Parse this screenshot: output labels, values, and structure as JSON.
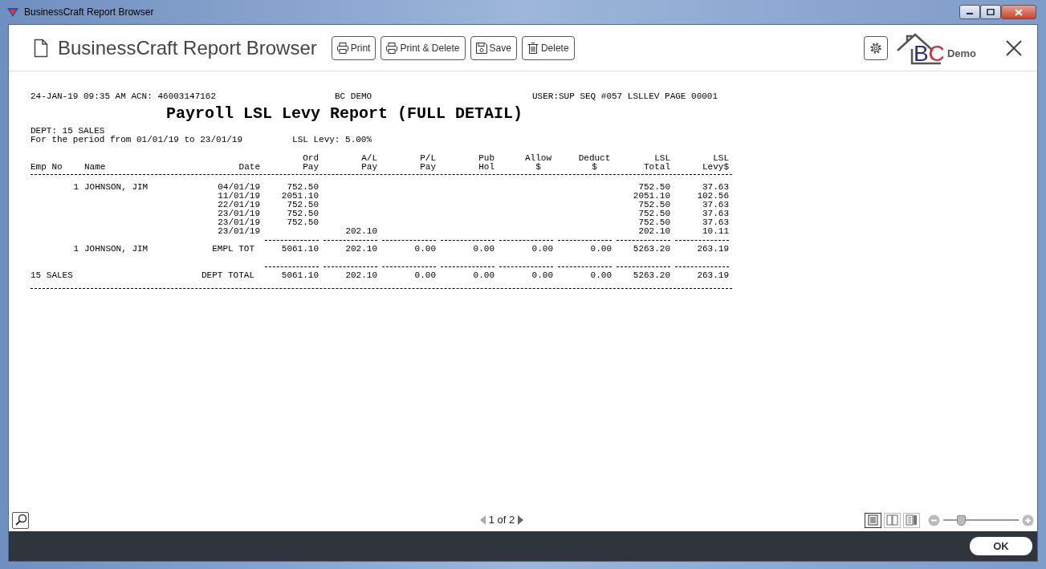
{
  "window": {
    "title": "BusinessCraft Report Browser"
  },
  "header": {
    "title": "BusinessCraft Report Browser",
    "buttons": [
      {
        "kind": "print",
        "label": "Print"
      },
      {
        "kind": "print",
        "label": "Print & Delete"
      },
      {
        "kind": "save",
        "label": "Save"
      },
      {
        "kind": "delete",
        "label": "Delete"
      }
    ],
    "logo": [
      {
        "text": "B",
        "color": "#2b2f7e"
      },
      {
        "text": "C",
        "color": "#d42a35"
      }
    ],
    "logo_caption": "Demo"
  },
  "report": {
    "header_left": "24-JAN-19 09:35 AM ACN: 46003147162",
    "header_center": "BC DEMO",
    "header_right": "USER:SUP SEQ #057 LSLLEV PAGE 00001",
    "title": "Payroll LSL Levy Report (FULL DETAIL)",
    "dept": "DEPT: 15 SALES",
    "period": "For the period from 01/01/19 to 23/01/19",
    "levy": "LSL Levy: 5.00%",
    "header_rows": [
      [
        null,
        null,
        null,
        "Ord",
        "A/L",
        "P/L",
        "Pub",
        "Allow",
        "Deduct",
        "LSL",
        "LSL"
      ],
      [
        "Emp No",
        "Name",
        "Date",
        "Pay",
        "Pay",
        "Pay",
        "Hol",
        "$",
        "$",
        "Total",
        "Levy$"
      ]
    ],
    "rows": [
      {
        "kind": "detail",
        "cells": [
          "1",
          "JOHNSON, JIM",
          "04/01/19",
          "752.50",
          null,
          null,
          null,
          null,
          null,
          "752.50",
          "37.63"
        ]
      },
      {
        "kind": "detail",
        "cells": [
          null,
          null,
          "11/01/19",
          "2051.10",
          null,
          null,
          null,
          null,
          null,
          "2051.10",
          "102.56"
        ]
      },
      {
        "kind": "detail",
        "cells": [
          null,
          null,
          "22/01/19",
          "752.50",
          null,
          null,
          null,
          null,
          null,
          "752.50",
          "37.63"
        ]
      },
      {
        "kind": "detail",
        "cells": [
          null,
          null,
          "23/01/19",
          "752.50",
          null,
          null,
          null,
          null,
          null,
          "752.50",
          "37.63"
        ]
      },
      {
        "kind": "detail",
        "cells": [
          null,
          null,
          "23/01/19",
          "752.50",
          null,
          null,
          null,
          null,
          null,
          "752.50",
          "37.63"
        ]
      },
      {
        "kind": "detail",
        "cells": [
          null,
          null,
          "23/01/19",
          null,
          "202.10",
          null,
          null,
          null,
          null,
          "202.10",
          "10.11"
        ]
      },
      {
        "kind": "subtotal",
        "cells": [
          "1",
          "JOHNSON, JIM",
          "EMPL TOT",
          "5061.10",
          "202.10",
          "0.00",
          "0.00",
          "0.00",
          "0.00",
          "5263.20",
          "263.19"
        ]
      },
      {
        "kind": "total",
        "cells": [
          "15 SALES",
          null,
          "DEPT TOTAL",
          "5061.10",
          "202.10",
          "0.00",
          "0.00",
          "0.00",
          "0.00",
          "5263.20",
          "263.19"
        ]
      }
    ]
  },
  "pager": {
    "text": "1 of 2"
  },
  "views": [
    {
      "selected": true
    },
    {
      "selected": false
    },
    {
      "selected": false
    }
  ],
  "zoom": {
    "level": 0.2
  },
  "ok_button": "OK"
}
